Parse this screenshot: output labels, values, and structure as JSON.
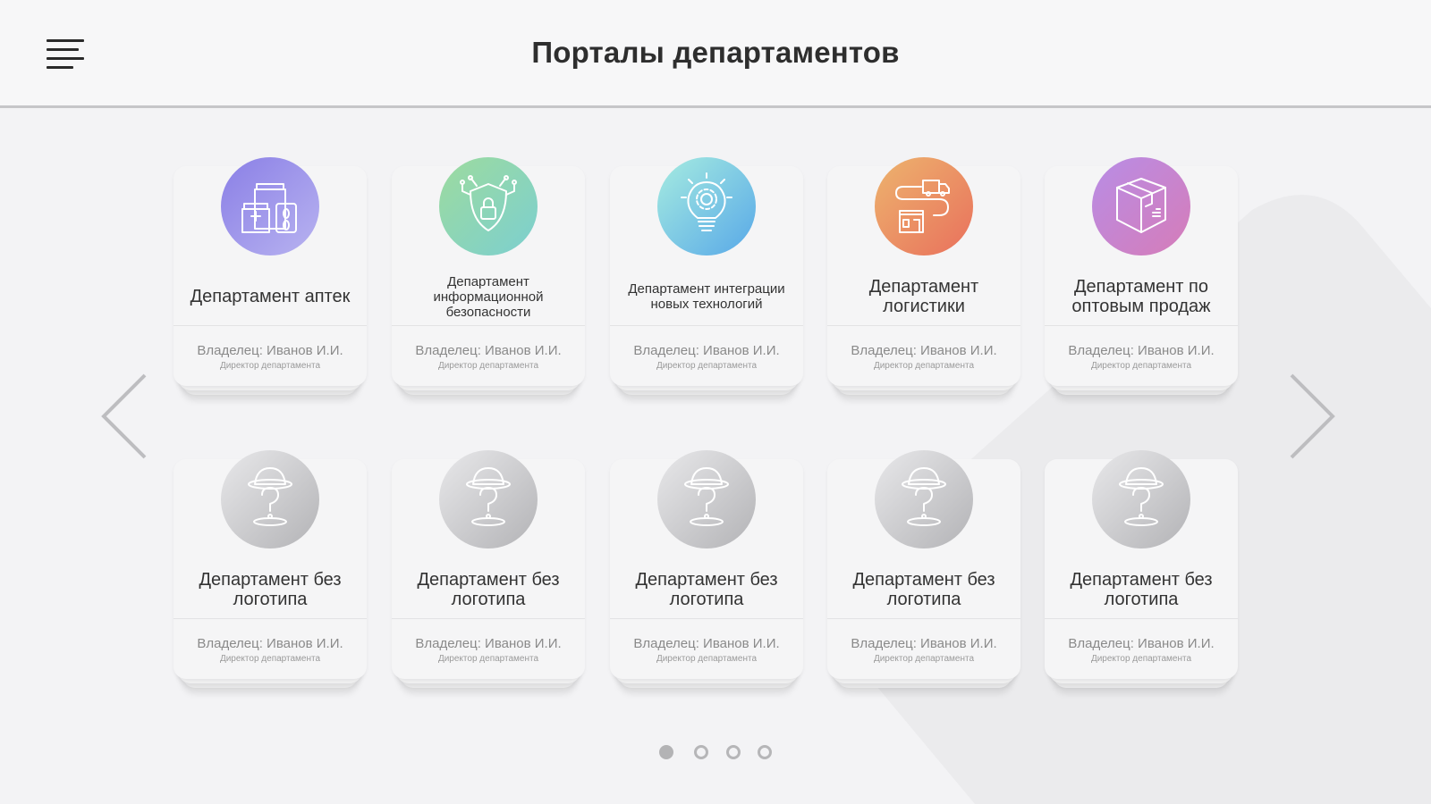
{
  "header": {
    "title": "Порталы департаментов",
    "menu_icon": "hamburger-menu-icon"
  },
  "navigation": {
    "prev_icon": "chevron-left-icon",
    "next_icon": "chevron-right-icon"
  },
  "cards": [
    {
      "name": "Департамент аптек",
      "size": "lg",
      "owner": "Владелец: Иванов И.И.",
      "role": "Директор департамента",
      "icon": "pharmacy-icon",
      "gradient": [
        "#8a7fe6",
        "#b8b3f0"
      ]
    },
    {
      "name": "Департамент информационной безопасности",
      "size": "sm",
      "owner": "Владелец: Иванов И.И.",
      "role": "Директор департамента",
      "icon": "security-shield-icon",
      "gradient": [
        "#9ddb9e",
        "#7ccfd0"
      ]
    },
    {
      "name": "Департамент интеграции новых технологий",
      "size": "sm",
      "owner": "Владелец: Иванов И.И.",
      "role": "Директор департамента",
      "icon": "lightbulb-gear-icon",
      "gradient": [
        "#a6ece0",
        "#58a8e8"
      ]
    },
    {
      "name": "Департамент логистики",
      "size": "lg",
      "owner": "Владелец: Иванов И.И.",
      "role": "Директор департамента",
      "icon": "delivery-truck-icon",
      "gradient": [
        "#edb46e",
        "#e9705c"
      ]
    },
    {
      "name": "Департамент по оптовым продаж",
      "size": "lg",
      "owner": "Владелец: Иванов И.И.",
      "role": "Директор департамента",
      "icon": "package-box-icon",
      "gradient": [
        "#b88de6",
        "#d67cb8"
      ]
    },
    {
      "name": "Департамент без логотипа",
      "size": "lg",
      "owner": "Владелец: Иванов И.И.",
      "role": "Директор департамента",
      "icon": "unknown-hat-icon",
      "gradient": [
        "#e8e8ea",
        "#b3b3b6"
      ]
    },
    {
      "name": "Департамент без логотипа",
      "size": "lg",
      "owner": "Владелец: Иванов И.И.",
      "role": "Директор департамента",
      "icon": "unknown-hat-icon",
      "gradient": [
        "#e8e8ea",
        "#b3b3b6"
      ]
    },
    {
      "name": "Департамент без логотипа",
      "size": "lg",
      "owner": "Владелец: Иванов И.И.",
      "role": "Директор департамента",
      "icon": "unknown-hat-icon",
      "gradient": [
        "#e8e8ea",
        "#b3b3b6"
      ]
    },
    {
      "name": "Департамент без логотипа",
      "size": "lg",
      "owner": "Владелец: Иванов И.И.",
      "role": "Директор департамента",
      "icon": "unknown-hat-icon",
      "gradient": [
        "#e8e8ea",
        "#b3b3b6"
      ]
    },
    {
      "name": "Департамент без логотипа",
      "size": "lg",
      "owner": "Владелец: Иванов И.И.",
      "role": "Директор департамента",
      "icon": "unknown-hat-icon",
      "gradient": [
        "#e8e8ea",
        "#b3b3b6"
      ]
    }
  ],
  "pagination": {
    "pages": 4,
    "current": 1
  }
}
